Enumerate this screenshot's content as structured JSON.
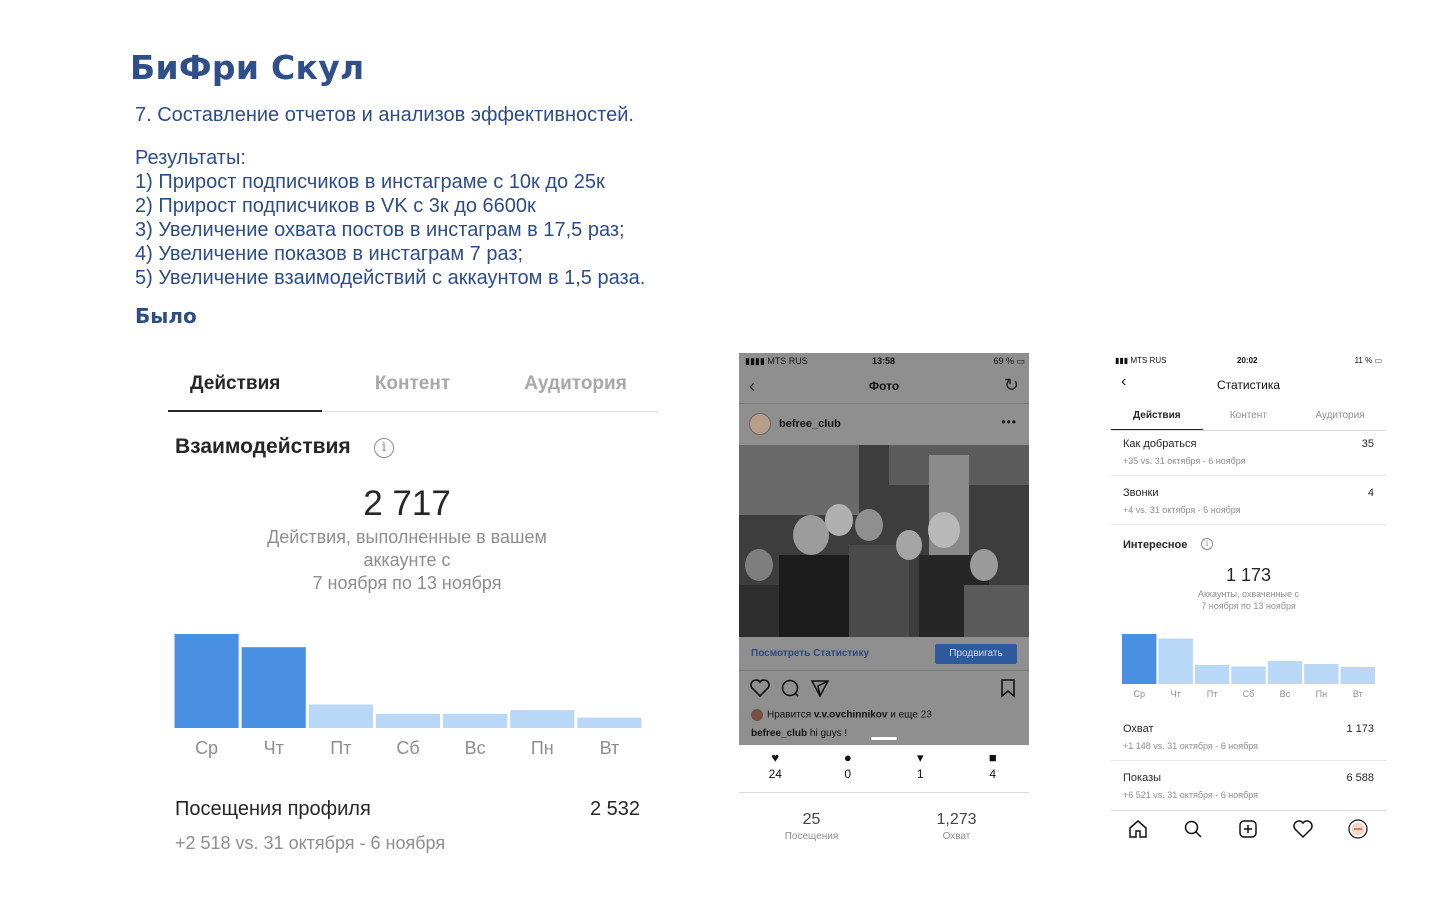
{
  "brand": "БиФри Скул",
  "subtitle": "7. Составление отчетов и анализов эффективностей.",
  "results": {
    "heading": "Результаты:",
    "items": [
      "1) Прирост подписчиков в инстаграме с 10к до 25к",
      "2) Прирост подписчиков в VK с 3к до 6600к",
      "3) Увеличение охвата постов в инстаграм в 17,5 раз;",
      "4) Увеличение показов в инстаграм 7 раз;",
      "5) Увеличение взаимодействий с аккаунтом в 1,5 раза."
    ]
  },
  "before_label": "Было",
  "panel1": {
    "tabs": [
      "Действия",
      "Контент",
      "Аудитория"
    ],
    "section_title": "Взаимодействия",
    "total": "2 717",
    "description_lines": [
      "Действия, выполненные в вашем",
      "аккаунте с",
      "7 ноября по 13 ноября"
    ],
    "profile_visits": {
      "label": "Посещения профиля",
      "value": "2 532",
      "comparison": "+2 518 vs. 31 октября - 6 ноября"
    },
    "colors": {
      "active_bar": "#4a90e2",
      "inactive_bar": "#b9d7f7"
    }
  },
  "panel2": {
    "status": {
      "carrier": "MTS RUS",
      "time": "13:58",
      "battery": "69 %"
    },
    "title": "Фото",
    "username": "befree_club",
    "view_stats": "Посмотреть Статистику",
    "promote": "Продвигать",
    "likes_prefix": "Нравится",
    "likes_user": "v.v.ovchinnikov",
    "likes_suffix": "и еще 23",
    "caption_user": "befree_club",
    "caption_text": "hi guys !",
    "counters": [
      {
        "icon": "heart-icon",
        "value": "24"
      },
      {
        "icon": "comment-icon",
        "value": "0"
      },
      {
        "icon": "share-icon",
        "value": "1"
      },
      {
        "icon": "bookmark-icon",
        "value": "4"
      }
    ],
    "visits": {
      "value": "25",
      "label": "Посещения"
    },
    "reach": {
      "value": "1,273",
      "label": "Охват"
    }
  },
  "panel3": {
    "status": {
      "carrier": "MTS RUS",
      "time": "20:02",
      "battery": "11 %"
    },
    "title": "Статистика",
    "tabs": [
      "Действия",
      "Контент",
      "Аудитория"
    ],
    "rows_top": [
      {
        "label": "Как добраться",
        "value": "35",
        "comparison": "+35 vs. 31 октября - 6 ноября"
      },
      {
        "label": "Звонки",
        "value": "4",
        "comparison": "+4 vs. 31 октября - 6 ноября"
      }
    ],
    "section_title": "Интересное",
    "total": "1 173",
    "description_lines": [
      "Аккаунты, охваченные с",
      "7 ноября по 13 ноября"
    ],
    "rows_bottom": [
      {
        "label": "Охват",
        "value": "1 173",
        "comparison": "+1 148 vs. 31 октября - 6 ноября"
      },
      {
        "label": "Показы",
        "value": "6 588",
        "comparison": "+6 521 vs. 31 октября - 6 ноября"
      }
    ]
  },
  "chart_data": [
    {
      "type": "bar",
      "categories": [
        "Ср",
        "Чт",
        "Пт",
        "Сб",
        "Вс",
        "Пн",
        "Вт"
      ],
      "values": [
        100,
        86,
        25,
        15,
        15,
        19,
        11
      ],
      "highlighted": [
        true,
        true,
        false,
        false,
        false,
        false,
        false
      ]
    },
    {
      "type": "bar",
      "categories": [
        "Ср",
        "Чт",
        "Пт",
        "Сб",
        "Вс",
        "Пн",
        "Вт"
      ],
      "values": [
        100,
        91,
        38,
        35,
        46,
        40,
        34
      ],
      "highlighted": [
        true,
        false,
        false,
        false,
        false,
        false,
        false
      ]
    }
  ]
}
